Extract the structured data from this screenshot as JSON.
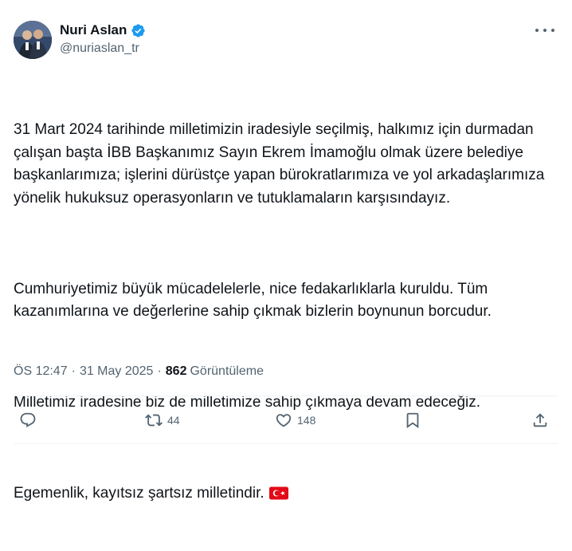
{
  "author": {
    "display_name": "Nuri Aslan",
    "handle": "@nuriaslan_tr",
    "verified": true,
    "verified_color": "#1d9bf0"
  },
  "tweet": {
    "paragraphs": [
      "31 Mart 2024 tarihinde milletimizin iradesiyle seçilmiş, halkımız için durmadan çalışan başta İBB Başkanımız Sayın Ekrem İmamoğlu olmak üzere belediye başkanlarımıza; işlerini dürüstçe yapan bürokratlarımıza ve yol arkadaşlarımıza yönelik hukuksuz operasyonların ve tutuklamaların karşısındayız.",
      "Cumhuriyetimiz büyük mücadelelerle, nice fedakarlıklarla kuruldu. Tüm kazanımlarına ve değerlerine sahip çıkmak bizlerin boynunun borcudur.",
      "Milletimiz iradesine biz de milletimize sahip çıkmaya devam edeceğiz.",
      "Egemenlik, kayıtsız şartsız milletindir."
    ],
    "trailing_emoji": "turkey-flag"
  },
  "meta": {
    "time": "ÖS 12:47",
    "separator": "·",
    "date": "31 May 2025",
    "views_count": "862",
    "views_label": "Görüntüleme"
  },
  "actions": {
    "reply_count": "",
    "retweet_count": "44",
    "like_count": "148"
  },
  "colors": {
    "text_primary": "#0f1419",
    "text_secondary": "#536471",
    "divider": "#eff3f4",
    "flag_red": "#e30a17"
  }
}
